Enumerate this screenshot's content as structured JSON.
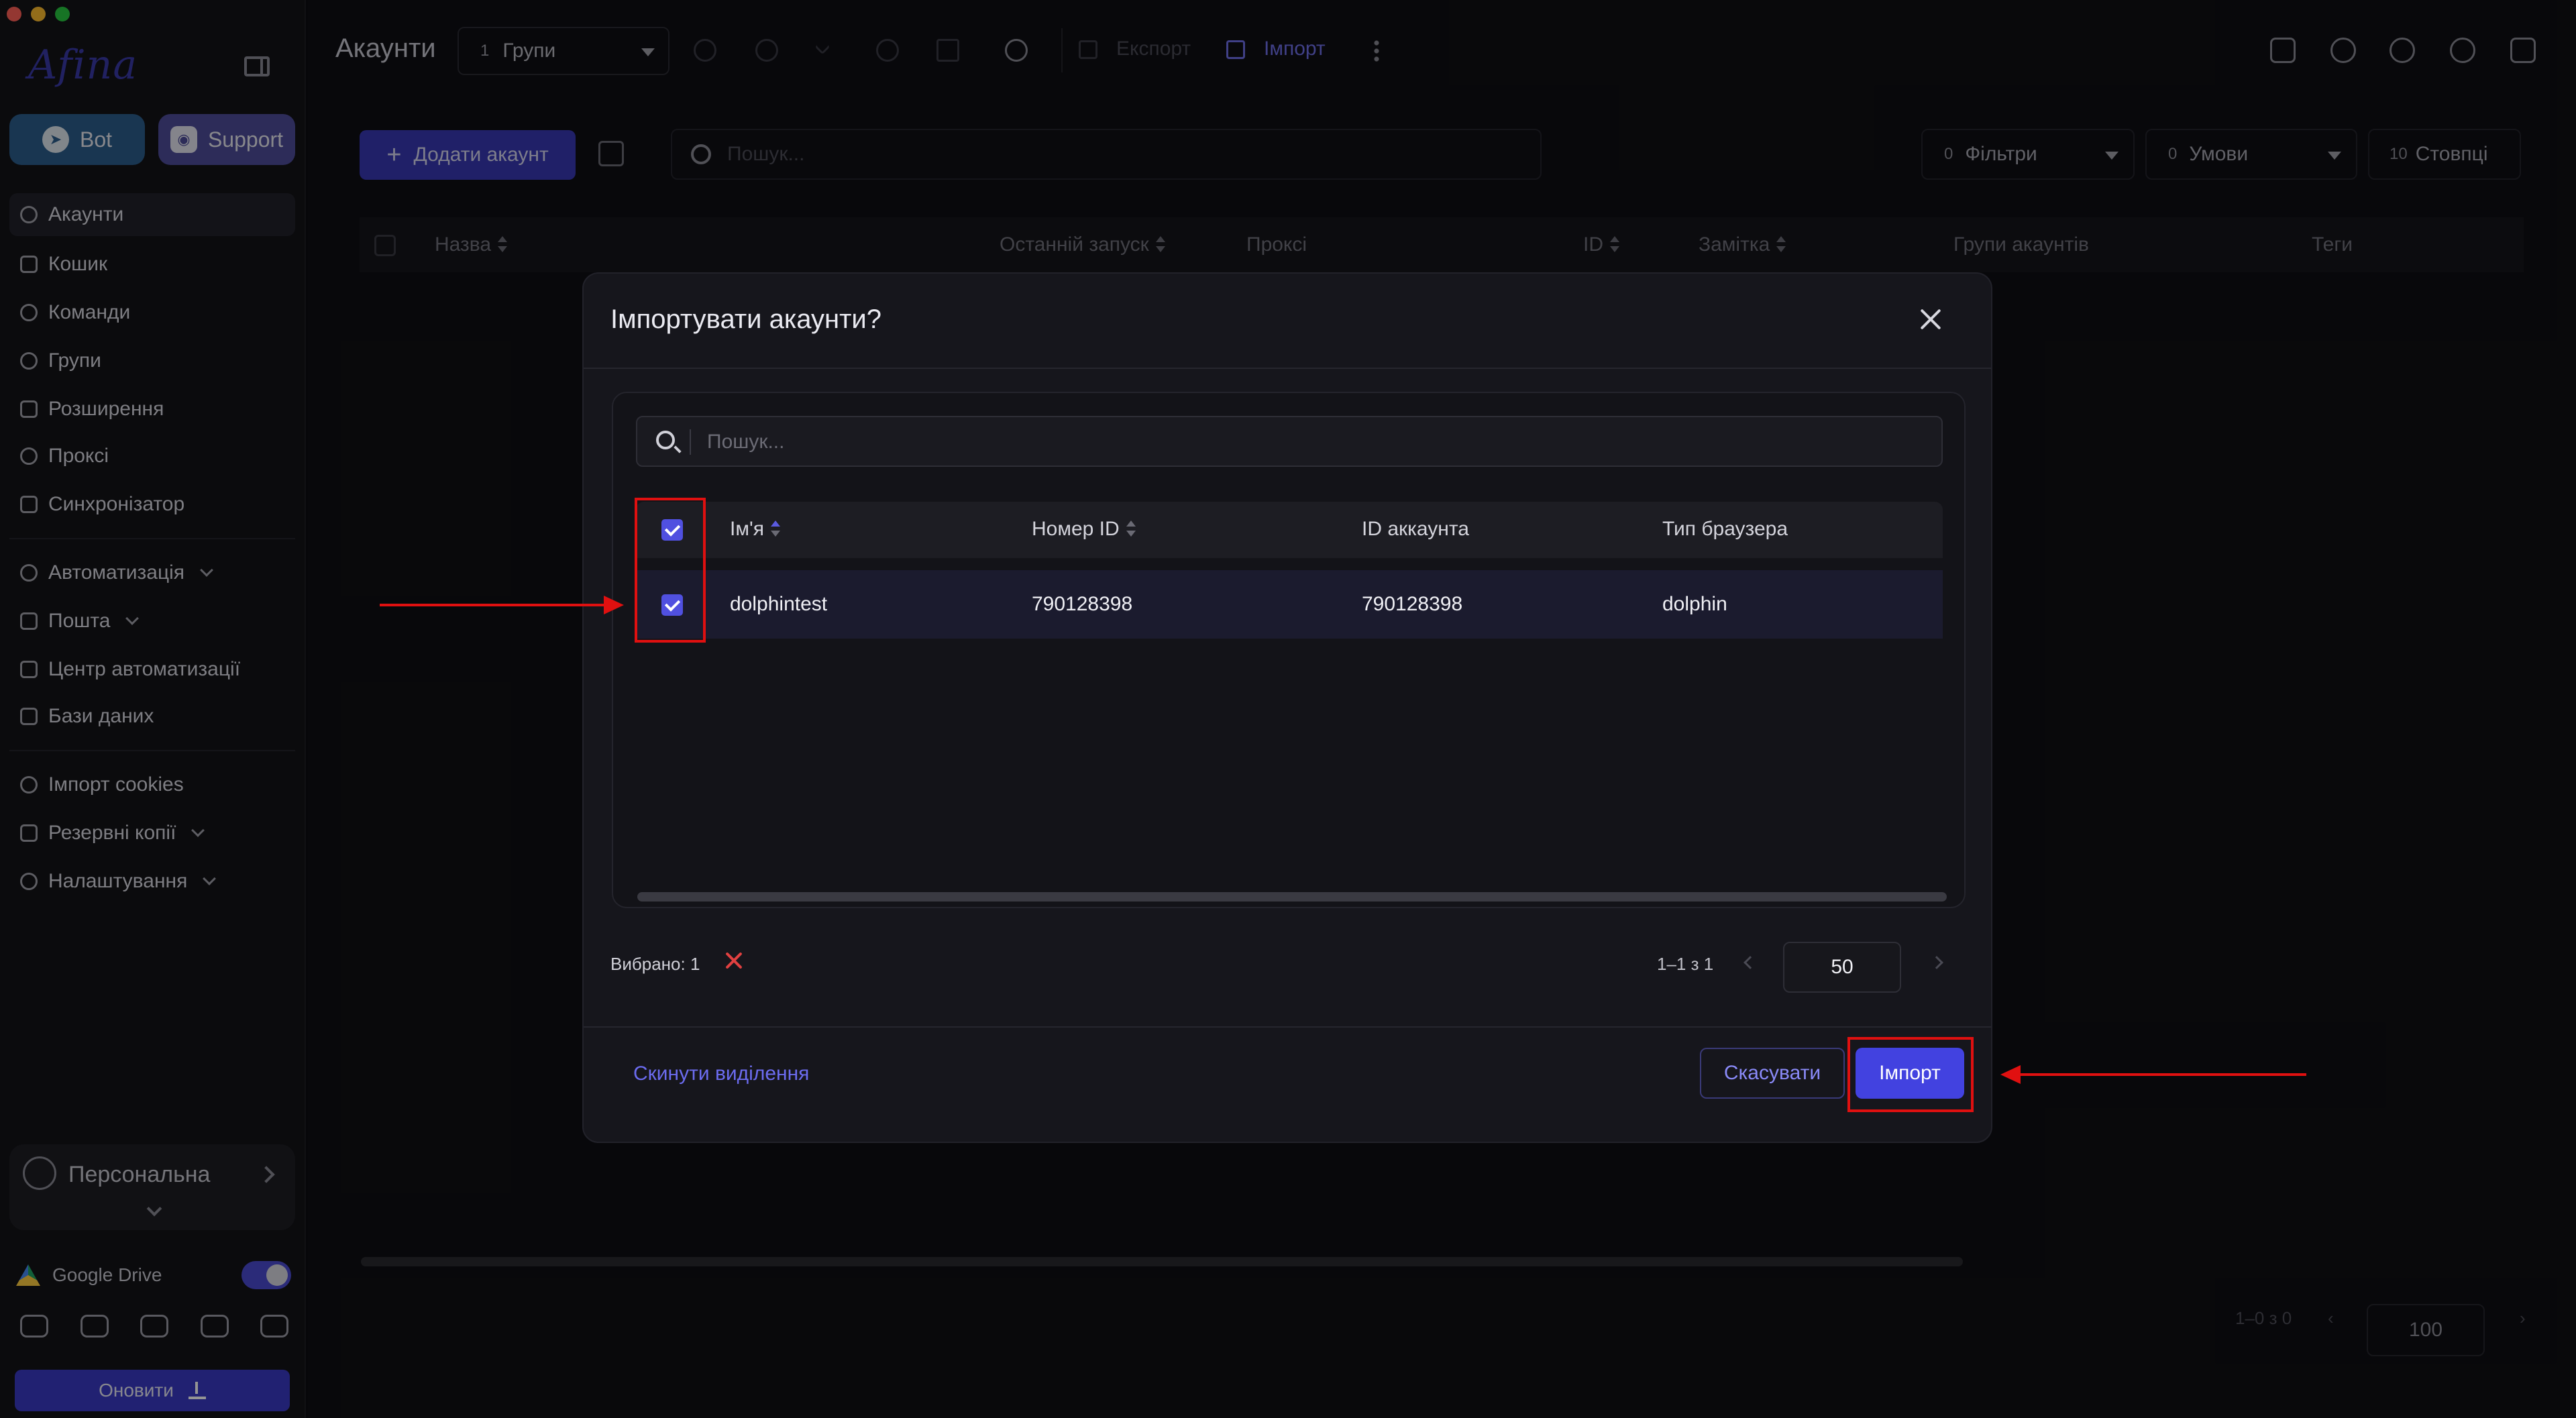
{
  "colors": {
    "accent": "#4242e0",
    "link": "#6c6cf0",
    "annotation": "#e01010",
    "bot_button": "#2c5d8c",
    "support_button": "#4e4c9a"
  },
  "sidebar": {
    "logo": "Afina",
    "bot_label": "Bot",
    "support_label": "Support",
    "items": [
      {
        "label": "Акаунти",
        "icon": "user-circle-icon"
      },
      {
        "label": "Кошик",
        "icon": "trash-icon"
      },
      {
        "label": "Команди",
        "icon": "team-icon"
      },
      {
        "label": "Групи",
        "icon": "group-icon"
      },
      {
        "label": "Розширення",
        "icon": "puzzle-icon"
      },
      {
        "label": "Проксі",
        "icon": "cloud-icon"
      },
      {
        "label": "Синхронізатор",
        "icon": "sync-icon"
      },
      {
        "label": "Автоматизація",
        "icon": "automation-icon"
      },
      {
        "label": "Пошта",
        "icon": "mail-icon"
      },
      {
        "label": "Центр автоматизації",
        "icon": "laptop-icon"
      },
      {
        "label": "Бази даних",
        "icon": "list-icon"
      },
      {
        "label": "Імпорт cookies",
        "icon": "cookie-icon"
      },
      {
        "label": "Резервні копії",
        "icon": "backup-icon"
      },
      {
        "label": "Налаштування",
        "icon": "gear-icon"
      }
    ],
    "profile_name": "Персональна",
    "gdrive_label": "Google Drive",
    "update_label": "Оновити"
  },
  "topbar": {
    "title": "Акаунти",
    "group_count": "1",
    "group_label": "Групи",
    "export_label": "Експорт",
    "import_label": "Імпорт"
  },
  "toolbar": {
    "add_label": "Додати акаунт",
    "search_placeholder": "Пошук...",
    "filters_count": "0",
    "filters_label": "Фільтри",
    "conditions_count": "0",
    "conditions_label": "Умови",
    "columns_count": "10",
    "columns_label": "Стовпці"
  },
  "grid": {
    "columns": [
      "Назва",
      "Останній запуск",
      "Проксі",
      "ID",
      "Замітка",
      "Групи акаунтів",
      "Теги"
    ],
    "pager_range": "1–0 з 0",
    "page_size": "100"
  },
  "modal": {
    "title": "Імпортувати акаунти?",
    "search_placeholder": "Пошук...",
    "columns": [
      "Ім'я",
      "Номер ID",
      "ID аккаунта",
      "Тип браузера"
    ],
    "rows": [
      {
        "name": "dolphintest",
        "number_id": "790128398",
        "account_id": "790128398",
        "browser": "dolphin",
        "checked": true
      }
    ],
    "selected_label": "Вибрано: 1",
    "pager_range": "1–1 з 1",
    "page_size": "50",
    "reset_label": "Скинути виділення",
    "cancel_label": "Скасувати",
    "import_label": "Імпорт"
  }
}
